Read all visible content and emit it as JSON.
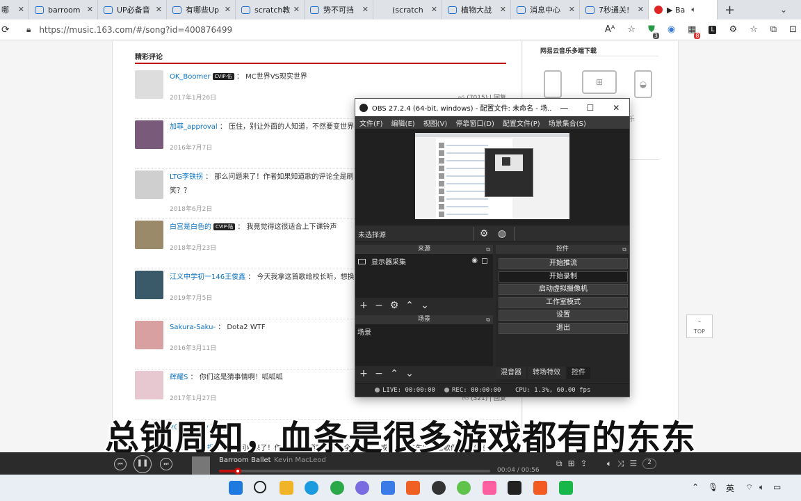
{
  "tabs": [
    {
      "title": "哪",
      "icon": "red-square-icon",
      "active": false
    },
    {
      "title": "barroom",
      "icon": "bilibili-tab-icon",
      "active": false
    },
    {
      "title": "UP必备音",
      "icon": "bilibili-tab-icon",
      "active": false
    },
    {
      "title": "有哪些Up",
      "icon": "bilibili-tab-icon",
      "active": false
    },
    {
      "title": "scratch教",
      "icon": "bilibili-tab-icon",
      "active": false
    },
    {
      "title": "势不可挡",
      "icon": "bilibili-tab-icon",
      "active": false
    },
    {
      "title": "(scratch",
      "icon": "blank-tab-icon",
      "active": false
    },
    {
      "title": "植物大战",
      "icon": "bilibili-tab-icon",
      "active": false
    },
    {
      "title": "消息中心",
      "icon": "bilibili-tab-icon",
      "active": false
    },
    {
      "title": "7秒通关!",
      "icon": "bilibili-tab-icon",
      "active": false
    },
    {
      "title": "▶ Ba",
      "icon": "netease-music-icon",
      "active": true
    }
  ],
  "address": {
    "url": "https://music.163.com/#/song?id=400876499"
  },
  "page": {
    "section_title": "精彩评论",
    "comments": [
      {
        "user": "OK_Boomer",
        "badge": "CVIP·伍",
        "text": "MC世界VS现实世界",
        "date": "2017年1月26日",
        "likes": "(7015)",
        "reply": "回复"
      },
      {
        "user": "加菲_approval",
        "badge": "",
        "text": "压住，别让外面的人知道，不然要变世界名",
        "date": "2016年7月7日",
        "likes": "",
        "reply": ""
      },
      {
        "user": "LTG李铁拐",
        "badge": "",
        "text": "那么问题来了！作者如果知道歌的评论全是刷",
        "text2": "笑？？",
        "date": "2018年6月2日",
        "likes": "",
        "reply": ""
      },
      {
        "user": "白宫是白色的",
        "badge": "CVIP·陆",
        "text": "我竟觉得这很适合上下课铃声",
        "date": "2018年2月23日",
        "likes": "",
        "reply": ""
      },
      {
        "user": "江义中学初一146王俊鑫",
        "badge": "",
        "text": "今天我拿这首歌给校长听，想换成",
        "date": "2019年7月5日",
        "likes": "",
        "reply": ""
      },
      {
        "user": "Sakura-Saku-",
        "badge": "",
        "text": "Dota2 WTF",
        "date": "2016年3月11日",
        "likes": "",
        "reply": ""
      },
      {
        "user": "辉耀S",
        "badge": "",
        "text": "你们这是猜事情啊！呱呱呱",
        "date": "2017年1月27日",
        "likes": "(321)",
        "reply": "回复"
      }
    ],
    "overlap_lines": {
      "user": "2024_Cody",
      "badge": "CVIP·陆",
      "user2": "LTG李铁拐",
      "text2": "那么问题来了！作者如果知道歌的评论全是刷对联 或者英雄先生的，这歌作者是该哭"
    },
    "side_title": "网易云音乐多端下载",
    "side_tag": "乐",
    "top_button": "TOP",
    "colors": {
      "accent": "#c20c0c",
      "link": "#0c73c2"
    }
  },
  "obs": {
    "title": "OBS 27.2.4 (64-bit, windows) - 配置文件: 未命名 - 场...",
    "menu": [
      "文件(F)",
      "编辑(E)",
      "视图(V)",
      "停靠窗口(D)",
      "配置文件(P)",
      "场景集合(S)"
    ],
    "no_source": "未选择源",
    "sources_title": "来源",
    "source_item": "显示器采集",
    "scenes_title": "场景",
    "scene_item": "场景",
    "controls_title": "控件",
    "controls": [
      "开始推流",
      "开始录制",
      "启动虚拟摄像机",
      "工作室模式",
      "设置",
      "退出"
    ],
    "dock_tabs": [
      "混音器",
      "转场特效",
      "控件"
    ],
    "status": {
      "live": "LIVE: 00:00:00",
      "rec": "REC: 00:00:00",
      "cpu": "CPU: 1.3%, 60.00 fps"
    }
  },
  "subtitle": "总锁周知，血条是很多游戏都有的东东",
  "player": {
    "song": "Barroom Ballet",
    "artist": "Kevin MacLeod",
    "time": "00:04 / 00:56",
    "progress": 0.07,
    "queue_count": "2"
  },
  "taskbar": {
    "ime": "英"
  }
}
